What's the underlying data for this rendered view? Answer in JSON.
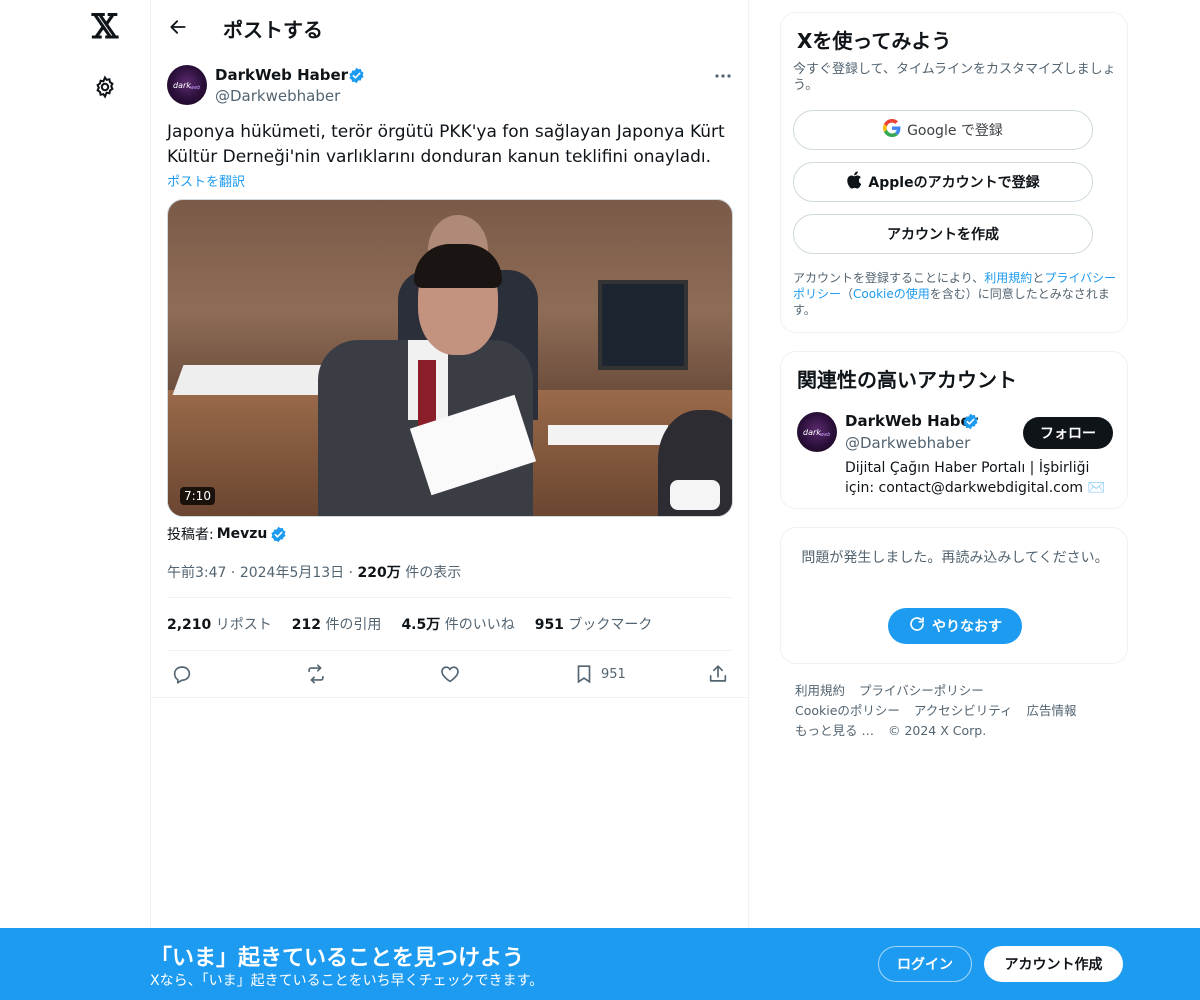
{
  "nav": {
    "logo_glyph": "𝕏",
    "settings_icon": "gear-icon"
  },
  "header": {
    "title": "ポストする"
  },
  "post": {
    "author_name": "DarkWeb Haber",
    "author_handle": "@Darkwebhaber",
    "text": "Japonya hükümeti, terör örgütü PKK'ya fon sağlayan Japonya Kürt Kültür Derneği'nin varlıklarını donduran kanun teklifini onayladı.",
    "translate_label": "ポストを翻訳",
    "video_duration": "7:10",
    "poster_label": "投稿者:",
    "poster_name": "Mevzu",
    "time": "午前3:47",
    "date": "2024年5月13日",
    "views_value": "220万",
    "views_label": "件の表示",
    "stats": {
      "reposts_value": "2,210",
      "reposts_label": "リポスト",
      "quotes_value": "212",
      "quotes_label": "件の引用",
      "likes_value": "4.5万",
      "likes_label": "件のいいね",
      "bookmarks_value": "951",
      "bookmarks_label": "ブックマーク"
    },
    "bookmark_count": "951"
  },
  "signup": {
    "title": "Xを使ってみよう",
    "subtitle": "今すぐ登録して、タイムラインをカスタマイズしましょう。",
    "google_label": "Google で登録",
    "apple_label": "Appleのアカウントで登録",
    "create_label": "アカウントを作成",
    "legal_prefix": "アカウントを登録することにより、",
    "legal_terms": "利用規約",
    "legal_and": "と",
    "legal_privacy": "プライバシーポリシー",
    "legal_paren_open": "（",
    "legal_cookie": "Cookieの使用",
    "legal_suffix": "を含む）に同意したとみなされます。"
  },
  "related": {
    "title": "関連性の高いアカウント",
    "name": "DarkWeb Haber",
    "handle": "@Darkwebhaber",
    "follow_label": "フォロー",
    "bio": "Dijital Çağın Haber Portalı | İşbirliği için: contact@darkwebdigital.com ✉️"
  },
  "error": {
    "text": "問題が発生しました。再読み込みしてください。",
    "retry_label": "やりなおす"
  },
  "footer": {
    "terms": "利用規約",
    "privacy": "プライバシーポリシー",
    "cookie": "Cookieのポリシー",
    "accessibility": "アクセシビリティ",
    "ads": "広告情報",
    "more": "もっと見る …",
    "copyright": "© 2024 X Corp."
  },
  "bottom_bar": {
    "title": "「いま」起きていることを見つけよう",
    "subtitle": "Xなら、「いま」起きていることをいち早くチェックできます。",
    "login_label": "ログイン",
    "create_label": "アカウント作成"
  },
  "colors": {
    "accent": "#1d9bf0",
    "text": "#0f1419",
    "secondary": "#536471",
    "border": "#eff3f4"
  }
}
